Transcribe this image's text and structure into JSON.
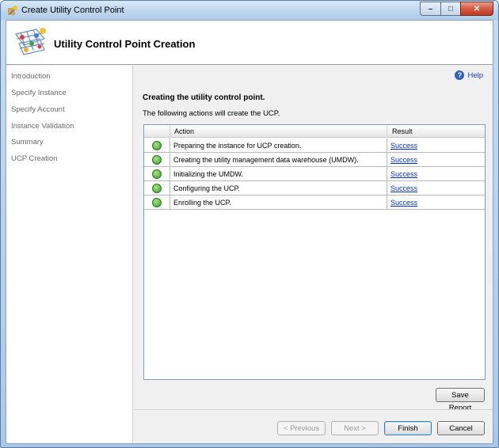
{
  "window": {
    "title": "Create Utility Control Point",
    "controls": {
      "minimize": "–",
      "maximize": "□",
      "close": "✕"
    }
  },
  "header": {
    "title": "Utility Control Point Creation",
    "icon": "utility-grid-icon"
  },
  "sidebar": {
    "items": [
      {
        "label": "Introduction"
      },
      {
        "label": "Specify Instance"
      },
      {
        "label": "Specify Account"
      },
      {
        "label": "Instance Validation"
      },
      {
        "label": "Summary"
      },
      {
        "label": "UCP Creation"
      }
    ]
  },
  "main": {
    "help_label": "Help",
    "section_title": "Creating the utility control point.",
    "section_subtitle": "The following actions will create the UCP.",
    "table": {
      "columns": [
        "Action",
        "Result"
      ],
      "rows": [
        {
          "status_icon": "success-check-icon",
          "action": "Preparing the instance for UCP creation.",
          "result": "Success"
        },
        {
          "status_icon": "success-check-icon",
          "action": "Creating the utility management data warehouse (UMDW).",
          "result": "Success"
        },
        {
          "status_icon": "success-check-icon",
          "action": "Initializing the UMDW.",
          "result": "Success"
        },
        {
          "status_icon": "success-check-icon",
          "action": "Configuring the UCP.",
          "result": "Success"
        },
        {
          "status_icon": "success-check-icon",
          "action": "Enrolling the UCP.",
          "result": "Success"
        }
      ]
    },
    "save_report_label": "Save Report"
  },
  "footer": {
    "previous_label": "< Previous",
    "next_label": "Next >",
    "finish_label": "Finish",
    "cancel_label": "Cancel"
  },
  "colors": {
    "link": "#0033cc",
    "success": "#3f9a2a",
    "title_bar": "#c1d7ee"
  }
}
